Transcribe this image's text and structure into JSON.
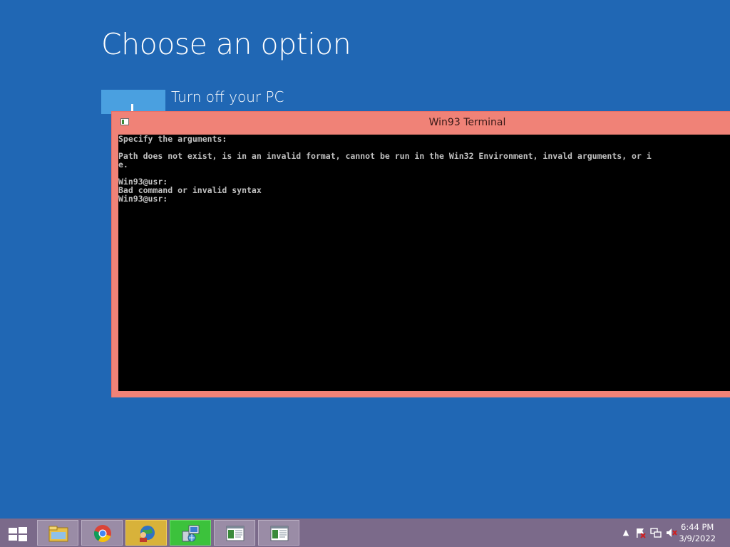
{
  "screen": {
    "heading": "Choose an option",
    "option": {
      "label": "Turn off your PC",
      "icon": "power-icon"
    },
    "background_color": "#2067b4"
  },
  "terminal": {
    "title": "Win93 Terminal",
    "accent_color": "#f08277",
    "lines": [
      "Specify the arguments:",
      "",
      "Path does not exist, is in an invalid format, cannot be run in the Win32 Environment, invald arguments, or i",
      "e.",
      "",
      "Win93@usr:",
      "Bad command or invalid syntax",
      "Win93@usr:"
    ]
  },
  "taskbar": {
    "start_icon": "windows-logo-icon",
    "apps": [
      {
        "name": "file-explorer",
        "icon": "folder-icon"
      },
      {
        "name": "chrome",
        "icon": "chrome-icon"
      },
      {
        "name": "internet-app",
        "icon": "globe-person-icon"
      },
      {
        "name": "network-setup",
        "icon": "network-computer-icon"
      },
      {
        "name": "terminal-window-1",
        "icon": "window-icon"
      },
      {
        "name": "terminal-window-2",
        "icon": "window-icon"
      }
    ],
    "tray": {
      "icons": [
        "show-hidden-icons-icon",
        "action-center-flag-icon",
        "network-icon",
        "volume-muted-icon"
      ],
      "time": "6:44 PM",
      "date": "3/9/2022"
    }
  }
}
